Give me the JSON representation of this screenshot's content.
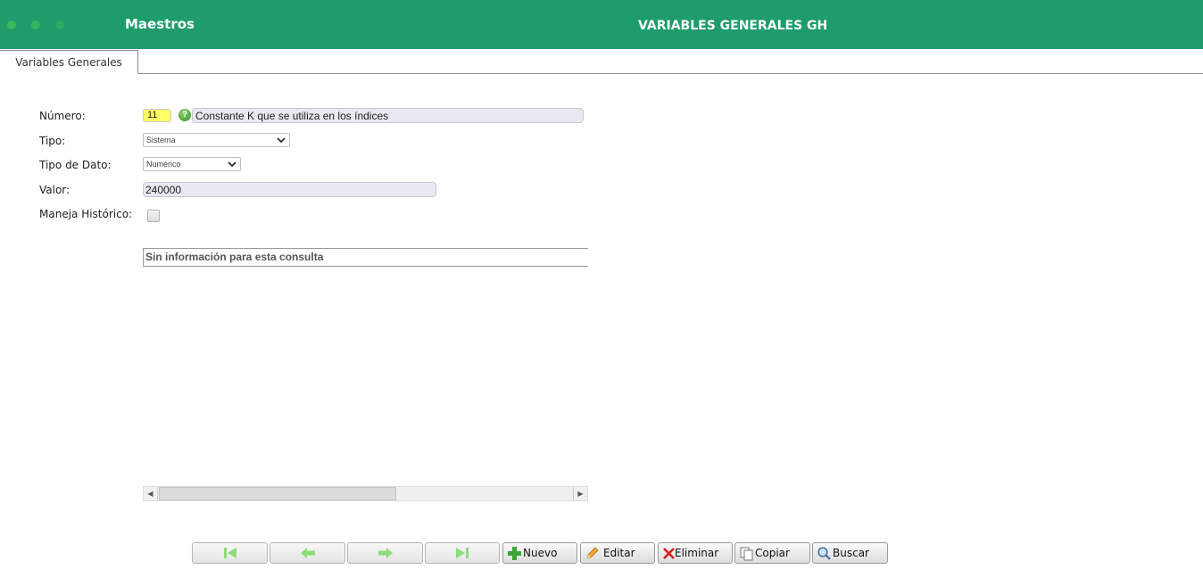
{
  "header": {
    "app_title": "Maestros",
    "page_title": "VARIABLES GENERALES GH",
    "bg_color": "#1e9c6b"
  },
  "tabs": [
    {
      "label": "Variables Generales",
      "active": true
    }
  ],
  "form": {
    "numero_label": "Número:",
    "numero_value": "11",
    "descripcion_value": "Constante K que se utiliza en los índices",
    "tipo_label": "Tipo:",
    "tipo_value": "Sistema",
    "tipo_dato_label": "Tipo de Dato:",
    "tipo_dato_value": "Numérico",
    "valor_label": "Valor:",
    "valor_value": "240000",
    "maneja_historico_label": "Maneja Histórico:",
    "maneja_historico_checked": false
  },
  "grid": {
    "empty_message": "Sin información para esta consulta"
  },
  "toolbar": {
    "first_icon": "first-record-icon",
    "prev_icon": "prev-record-icon",
    "next_icon": "next-record-icon",
    "last_icon": "last-record-icon",
    "nuevo_label": "Nuevo",
    "editar_label": "Editar",
    "eliminar_label": "Eliminar",
    "copiar_label": "Copiar",
    "buscar_label": "Buscar"
  }
}
